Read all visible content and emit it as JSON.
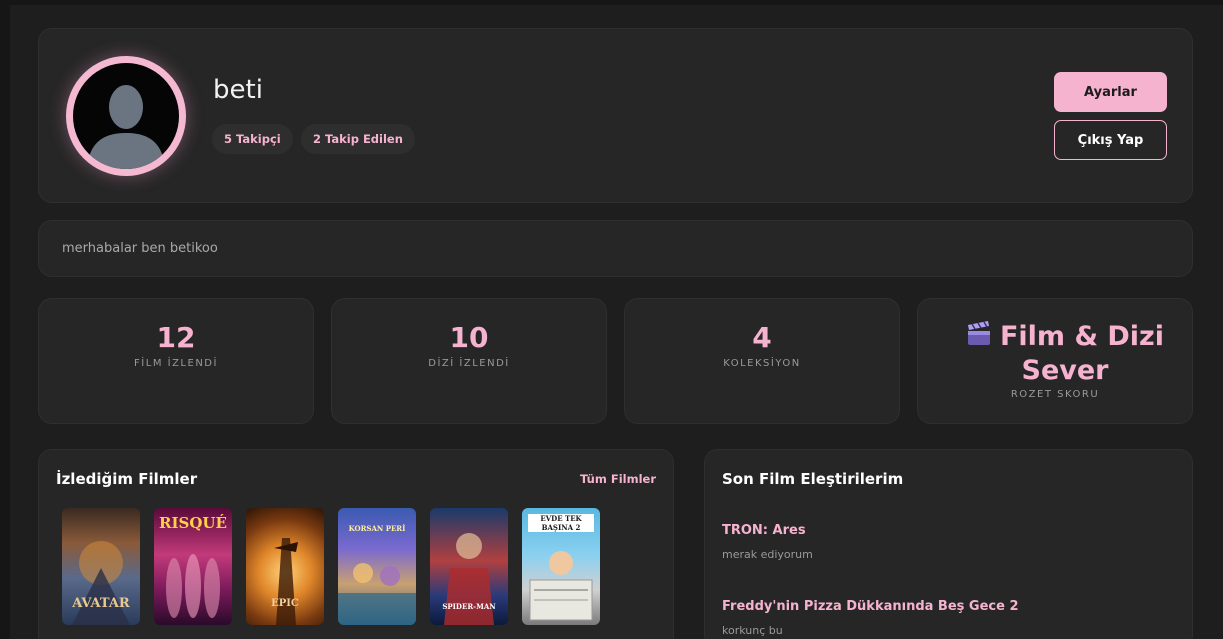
{
  "profile": {
    "username": "beti",
    "followers_label": "5 Takipçi",
    "following_label": "2 Takip Edilen",
    "settings_label": "Ayarlar",
    "logout_label": "Çıkış Yap",
    "accent_color": "#f6b3cf"
  },
  "bio": {
    "text": "merhabalar ben betikoo"
  },
  "stats": [
    {
      "value": "12",
      "label": "FİLM İZLENDİ"
    },
    {
      "value": "10",
      "label": "DİZİ İZLENDİ"
    },
    {
      "value": "4",
      "label": "KOLEKSİYON"
    }
  ],
  "badge": {
    "icon": "clapperboard-icon",
    "title": "Film & Dizi Sever",
    "label": "ROZET SKORU"
  },
  "movies": {
    "title": "İzlediğim Filmler",
    "see_all_label": "Tüm Filmler",
    "posters": [
      {
        "logo": "AVATAR"
      },
      {
        "logo": "RISQUÉ"
      },
      {
        "logo": "EPIC"
      },
      {
        "logo": "KORSAN PERİ"
      },
      {
        "logo": "SPIDER-MAN"
      },
      {
        "logo": "EVDE TEK BAŞINA 2"
      }
    ]
  },
  "reviews": {
    "title": "Son Film Eleştirilerim",
    "items": [
      {
        "movie": "TRON: Ares",
        "text": "merak ediyorum"
      },
      {
        "movie": "Freddy'nin Pizza Dükkanında Beş Gece 2",
        "text": "korkunç bu"
      }
    ]
  }
}
